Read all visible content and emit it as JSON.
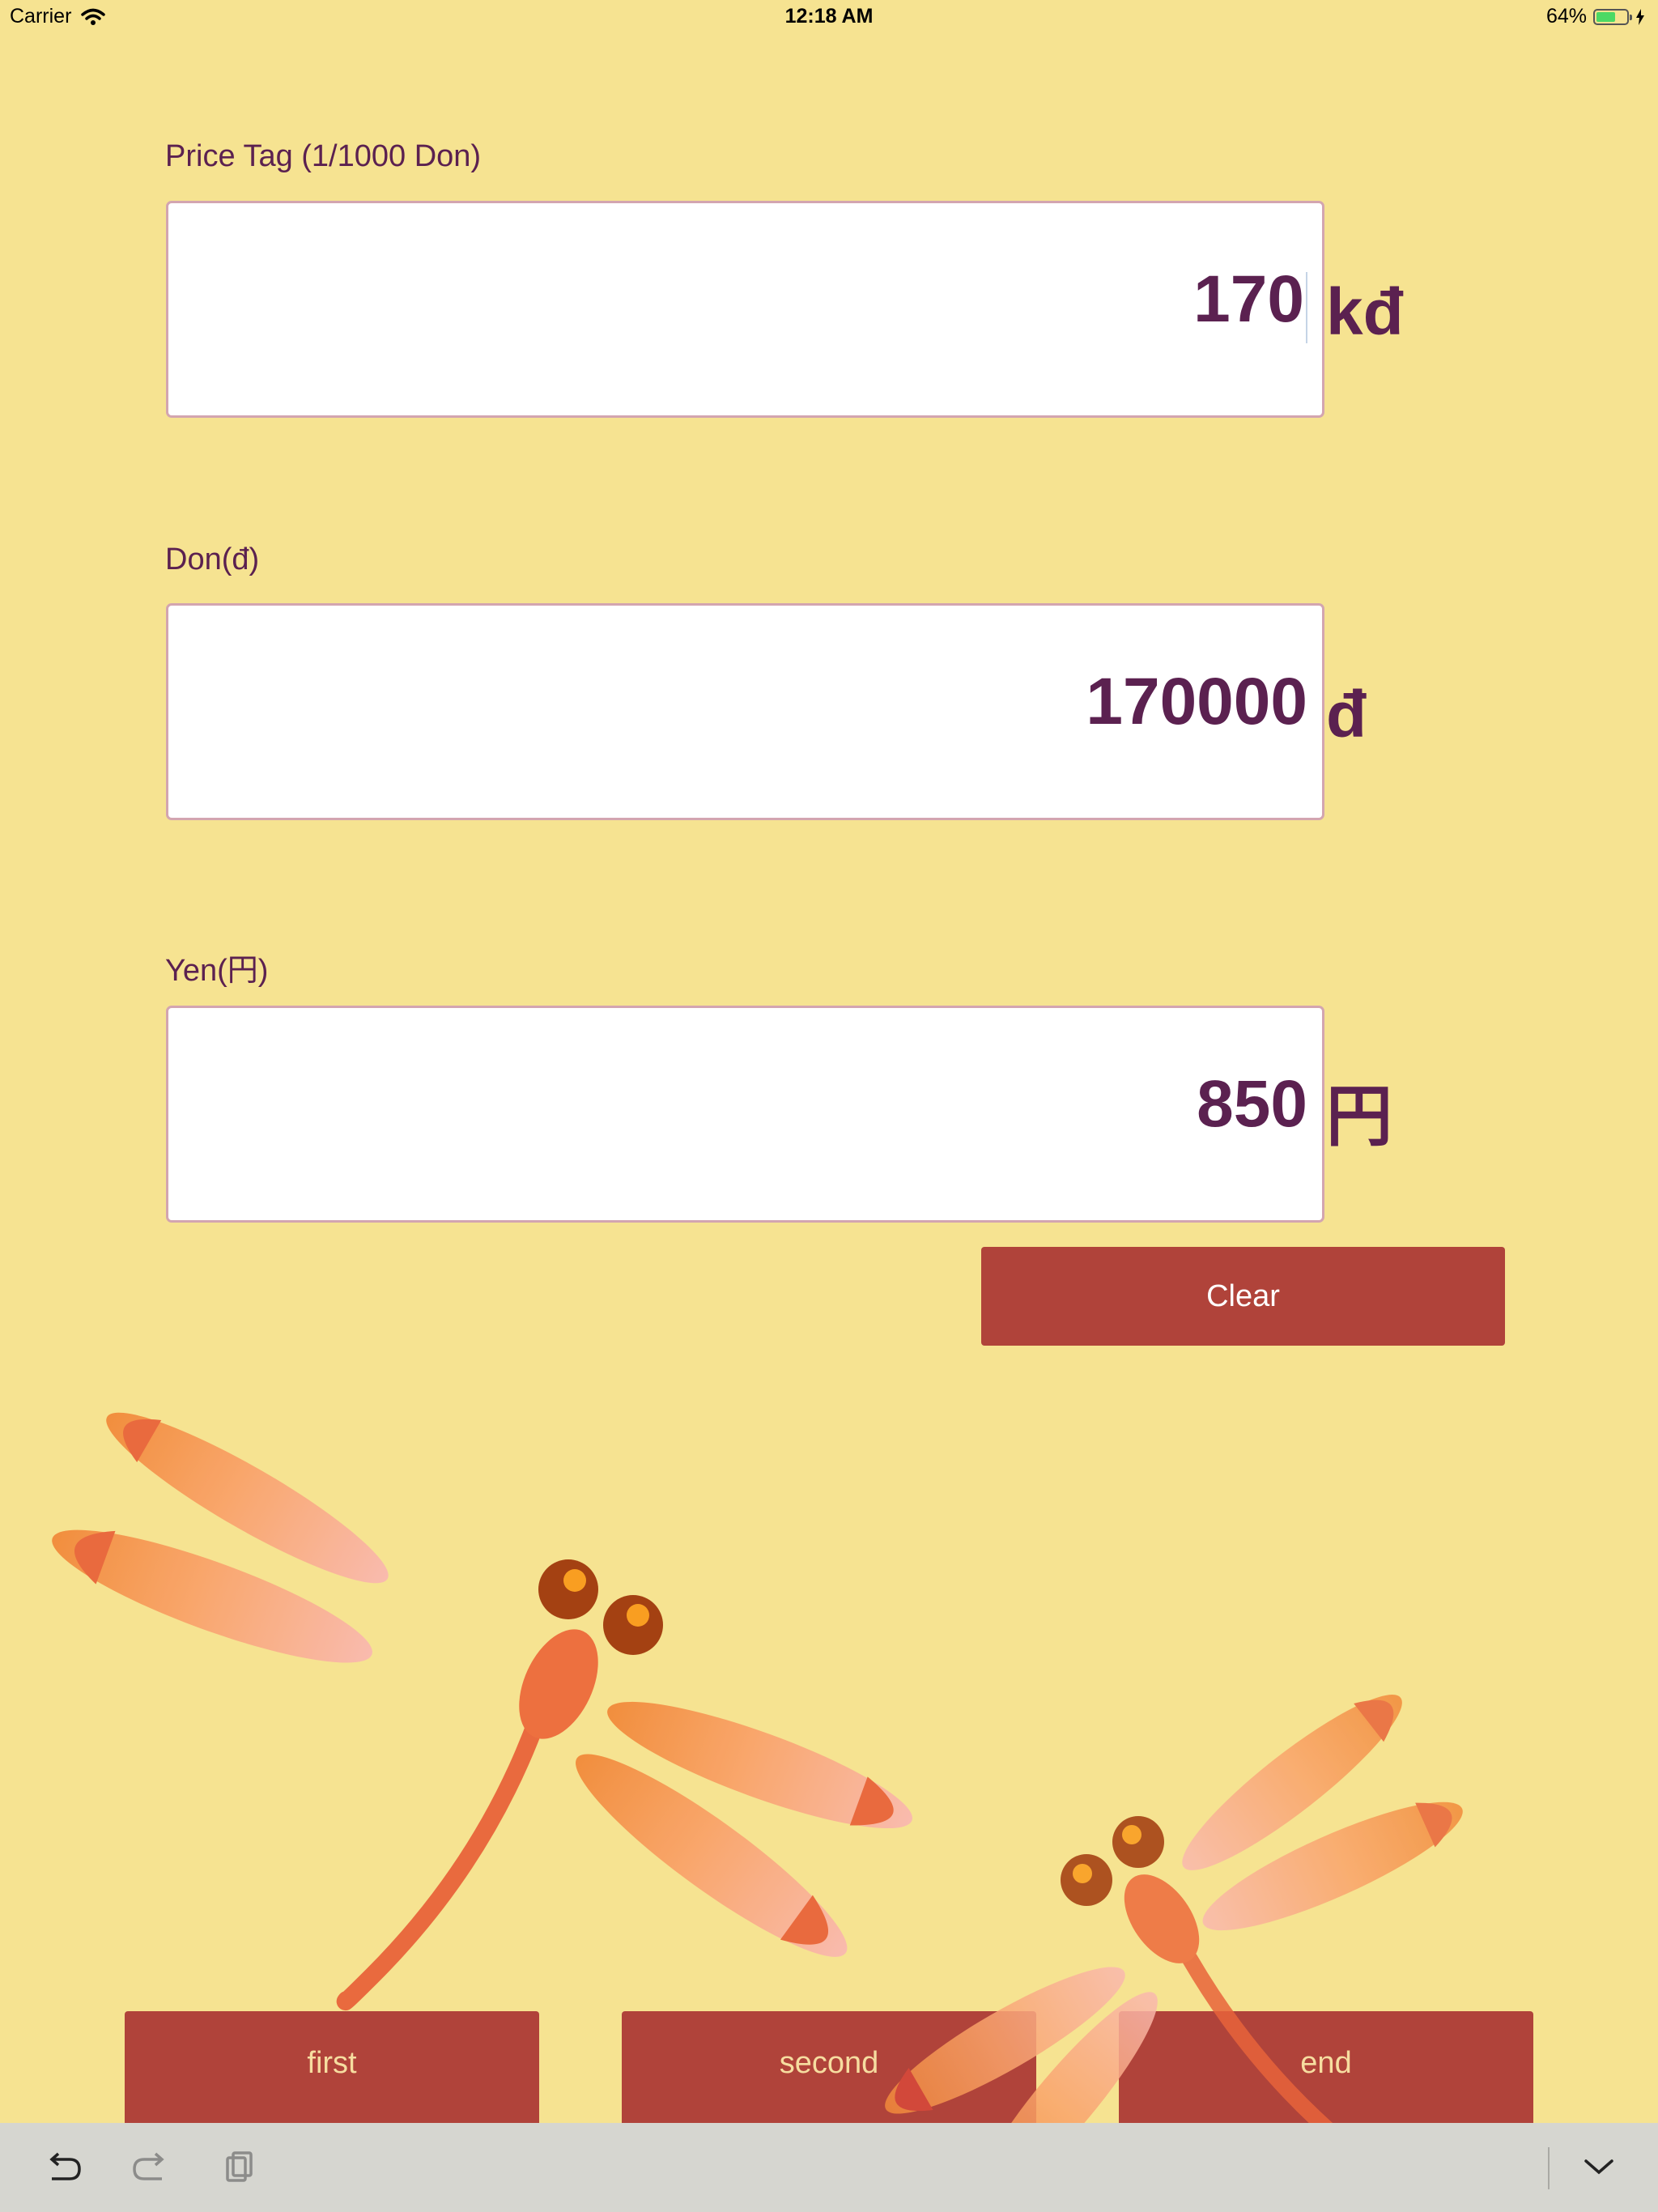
{
  "status_bar": {
    "carrier": "Carrier",
    "time": "12:18 AM",
    "battery_percent": "64%",
    "battery_level": 0.64
  },
  "fields": {
    "price_tag": {
      "label": "Price Tag (1/1000 Don)",
      "value": "170",
      "unit": "kđ"
    },
    "don": {
      "label": "Don(đ)",
      "value": "170000",
      "unit": "đ"
    },
    "yen": {
      "label": "Yen(円)",
      "value": "850",
      "unit": "円"
    }
  },
  "clear_button": {
    "label": "Clear"
  },
  "bottom_buttons": {
    "first": "first",
    "second": "second",
    "end": "end"
  },
  "toolbar": {
    "undo_icon": "undo-icon",
    "redo_icon": "redo-icon",
    "paste_icon": "paste-icon",
    "dismiss_icon": "chevron-down-icon"
  },
  "colors": {
    "background": "#f6e391",
    "text": "#5b2150",
    "button": "#b0433a",
    "field_border": "#d3a5b0",
    "toolbar": "#d6d6d0"
  }
}
